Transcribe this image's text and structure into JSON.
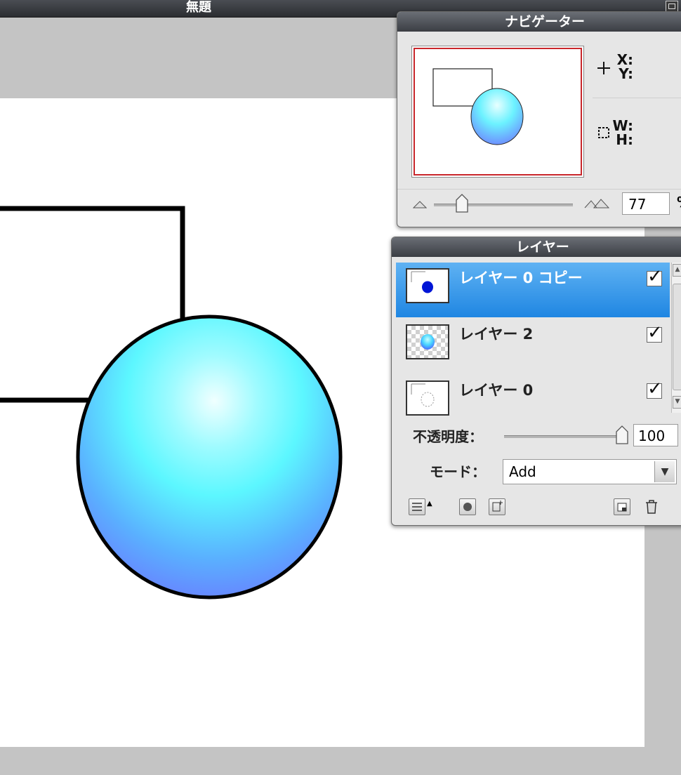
{
  "document": {
    "title": "無題"
  },
  "navigator": {
    "title": "ナビゲーター",
    "x_label": "X:",
    "y_label": "Y:",
    "w_label": "W:",
    "h_label": "H:",
    "zoom_value": "77",
    "zoom_unit": "%",
    "zoom_slider_level_percent": 20
  },
  "layers": {
    "title": "レイヤー",
    "items": [
      {
        "name": "レイヤー 0 コピー",
        "visible": true,
        "selected": true
      },
      {
        "name": "レイヤー 2",
        "visible": true,
        "selected": false
      },
      {
        "name": "レイヤー 0",
        "visible": true,
        "selected": false
      }
    ],
    "opacity_label": "不透明度：",
    "opacity_value": "100",
    "opacity_slider_level_percent": 100,
    "mode_label": "モード：",
    "mode_value": "Add"
  },
  "colors": {
    "selection": "#2e8ee6",
    "navigator_viewport": "#c8262b",
    "sphere_top": "#5cf7ff",
    "sphere_bottom": "#6a7bff"
  }
}
